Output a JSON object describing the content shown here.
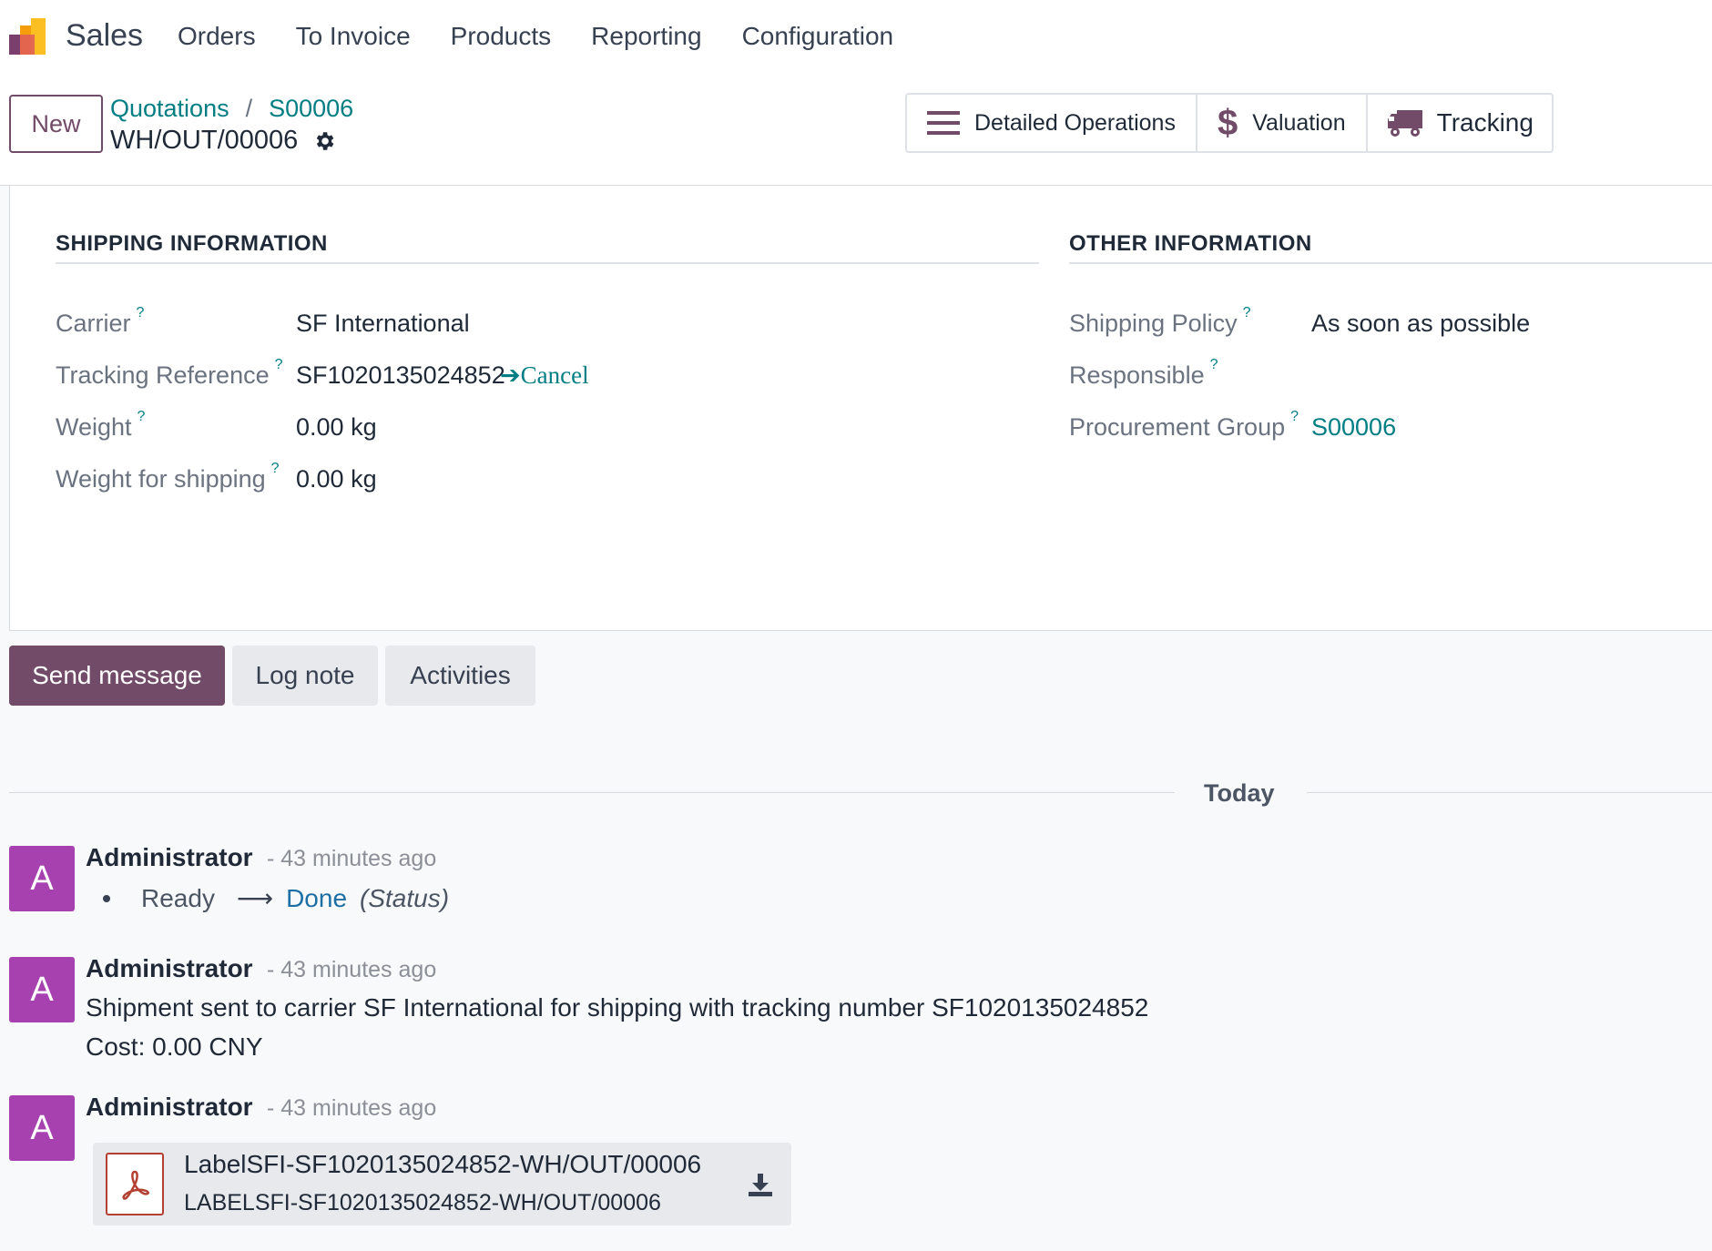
{
  "navbar": {
    "app_name": "Sales",
    "menu": [
      "Orders",
      "To Invoice",
      "Products",
      "Reporting",
      "Configuration"
    ]
  },
  "control_panel": {
    "new_label": "New",
    "breadcrumb": [
      "Quotations",
      "S00006"
    ],
    "breadcrumb_separator": "/",
    "record_name": "WH/OUT/00006"
  },
  "smart_buttons": {
    "detailed_operations": "Detailed Operations",
    "valuation": "Valuation",
    "tracking": "Tracking"
  },
  "shipping_information": {
    "title": "SHIPPING INFORMATION",
    "fields": [
      {
        "label": "Carrier",
        "value": "SF International"
      },
      {
        "label": "Tracking Reference",
        "value": "SF1020135024852",
        "action": "Cancel"
      },
      {
        "label": "Weight",
        "value": "0.00",
        "unit": "kg"
      },
      {
        "label": "Weight for shipping",
        "value": "0.00",
        "unit": "kg"
      }
    ]
  },
  "other_information": {
    "title": "OTHER INFORMATION",
    "fields": [
      {
        "label": "Shipping Policy",
        "value": "As soon as possible"
      },
      {
        "label": "Responsible",
        "value": ""
      },
      {
        "label": "Procurement Group",
        "value": "S00006"
      }
    ]
  },
  "help_marker": "?",
  "chatter": {
    "buttons": {
      "send": "Send message",
      "log": "Log note",
      "activities": "Activities"
    },
    "day_separator": "Today",
    "messages": [
      {
        "avatar": "A",
        "author": "Administrator",
        "time": "- 43 minutes ago",
        "tracking": {
          "old": "Ready",
          "new": "Done",
          "field": "(Status)"
        }
      },
      {
        "avatar": "A",
        "author": "Administrator",
        "time": "- 43 minutes ago",
        "lines": [
          "Shipment sent to carrier SF International for shipping with tracking number SF1020135024852",
          "Cost: 0.00 CNY"
        ]
      },
      {
        "avatar": "A",
        "author": "Administrator",
        "time": "- 43 minutes ago",
        "attachment": {
          "name": "LabelSFI-SF1020135024852-WH/OUT/00006",
          "subtitle": "LABELSFI-SF1020135024852-WH/OUT/00006"
        }
      }
    ]
  },
  "colors": {
    "brand": "#714b67",
    "link": "#017e84",
    "avatar": "#a741b0",
    "tracking_new": "#1d6fa5"
  },
  "icons": [
    "app-logo-icon",
    "gear-icon",
    "list-icon",
    "dollar-icon",
    "truck-icon",
    "arrow-right-icon",
    "pdf-icon",
    "download-icon"
  ]
}
